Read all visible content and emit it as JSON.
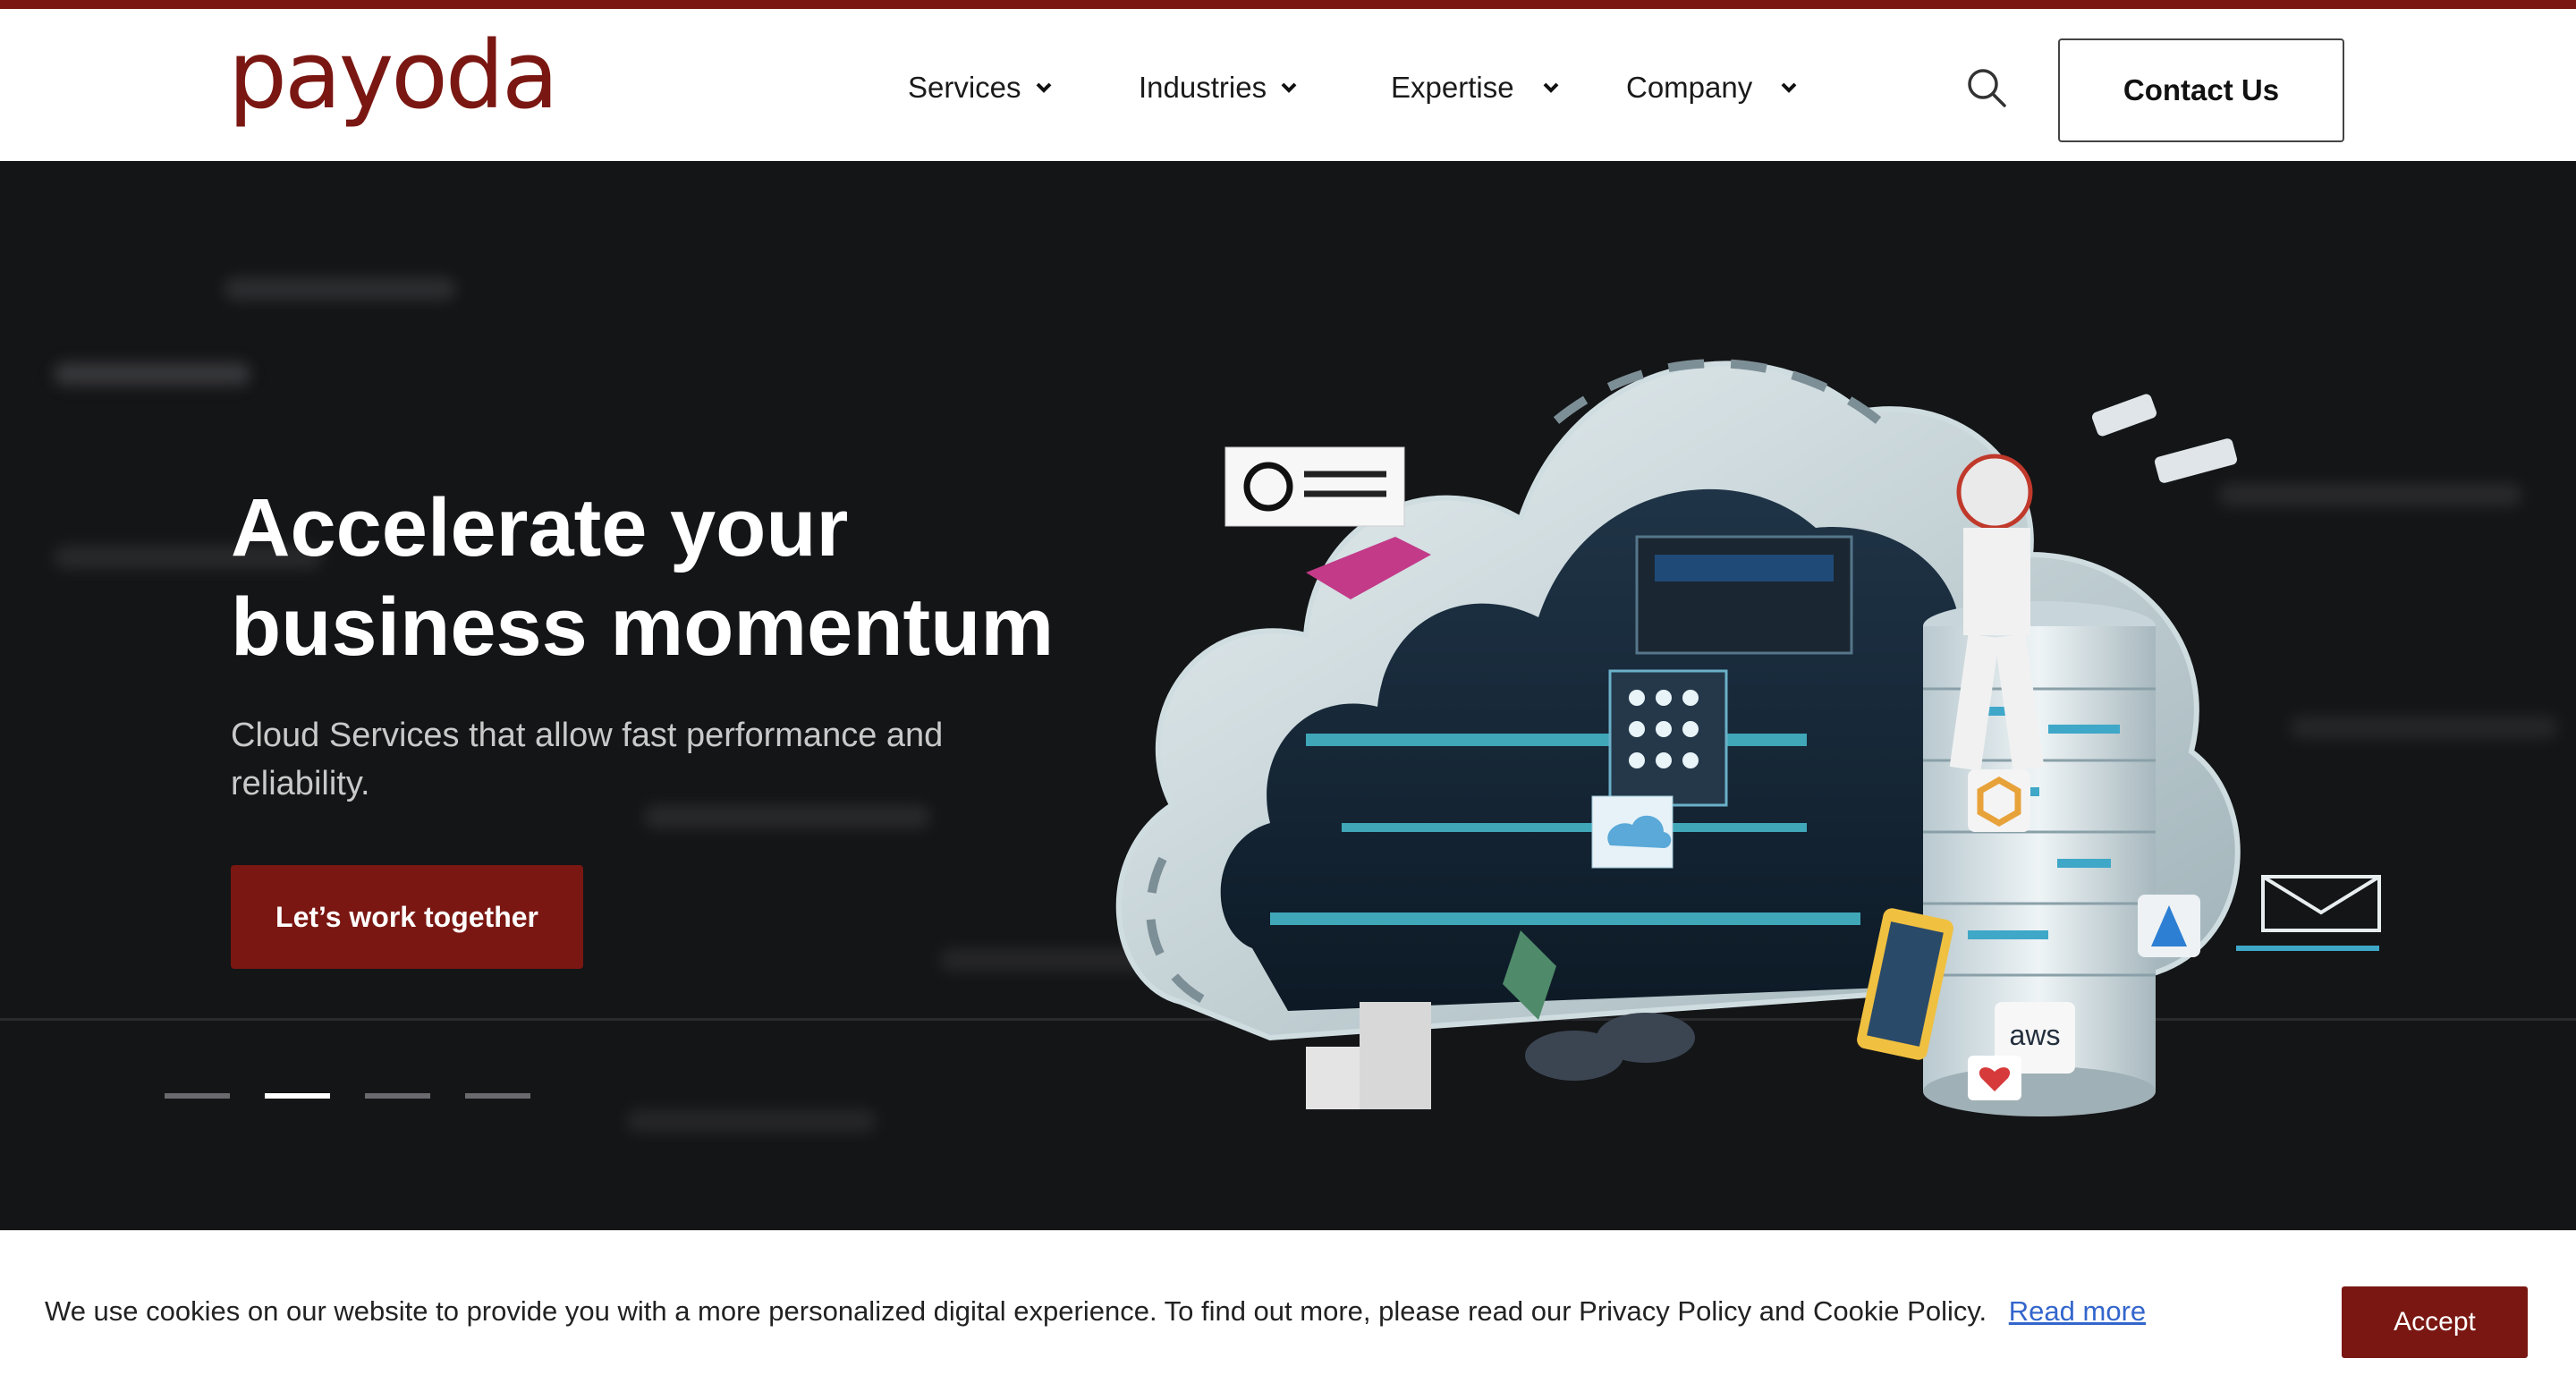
{
  "brand": {
    "logo_text": "payoda",
    "accent_color": "#7a1712"
  },
  "nav": {
    "items": [
      {
        "label": "Services"
      },
      {
        "label": "Industries"
      },
      {
        "label": "Expertise"
      },
      {
        "label": "Company"
      }
    ],
    "search_icon": "search-icon",
    "contact_label": "Contact Us"
  },
  "hero": {
    "headline_line1": "Accelerate your",
    "headline_line2": "business momentum",
    "subtext": "Cloud Services that allow fast performance and reliability.",
    "cta_label": "Let’s work together",
    "slides_total": 4,
    "active_slide": 2,
    "illustration_labels": {
      "cloud_badge": "aws"
    }
  },
  "cookie": {
    "message": "We use cookies on our website to provide you with a more personalized digital experience. To find out more, please read our Privacy Policy and Cookie Policy.",
    "read_more": "Read more",
    "accept_label": "Accept"
  }
}
